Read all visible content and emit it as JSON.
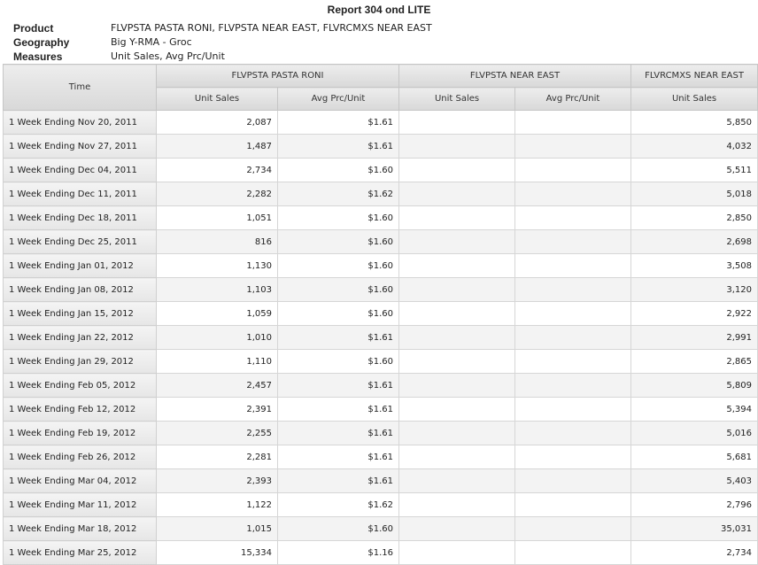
{
  "report": {
    "title": "Report 304 ond LITE",
    "meta": [
      {
        "label": "Product",
        "value": "FLVPSTA PASTA RONI, FLVPSTA NEAR EAST, FLVRCMXS NEAR EAST"
      },
      {
        "label": "Geography",
        "value": "Big Y-RMA - Groc"
      },
      {
        "label": "Measures",
        "value": "Unit Sales, Avg Prc/Unit"
      }
    ]
  },
  "table": {
    "time_header": "Time",
    "groups": [
      "FLVPSTA PASTA RONI",
      "FLVPSTA NEAR EAST",
      "FLVRCMXS NEAR EAST"
    ],
    "subheaders": [
      "Unit Sales",
      "Avg Prc/Unit",
      "Unit Sales",
      "Avg Prc/Unit",
      "Unit Sales"
    ],
    "rows": [
      {
        "time": "1 Week Ending Nov 20, 2011",
        "c1": "2,087",
        "c2": "$1.61",
        "c3": "",
        "c4": "",
        "c5": "5,850"
      },
      {
        "time": "1 Week Ending Nov 27, 2011",
        "c1": "1,487",
        "c2": "$1.61",
        "c3": "",
        "c4": "",
        "c5": "4,032"
      },
      {
        "time": "1 Week Ending Dec 04, 2011",
        "c1": "2,734",
        "c2": "$1.60",
        "c3": "",
        "c4": "",
        "c5": "5,511"
      },
      {
        "time": "1 Week Ending Dec 11, 2011",
        "c1": "2,282",
        "c2": "$1.62",
        "c3": "",
        "c4": "",
        "c5": "5,018"
      },
      {
        "time": "1 Week Ending Dec 18, 2011",
        "c1": "1,051",
        "c2": "$1.60",
        "c3": "",
        "c4": "",
        "c5": "2,850"
      },
      {
        "time": "1 Week Ending Dec 25, 2011",
        "c1": "816",
        "c2": "$1.60",
        "c3": "",
        "c4": "",
        "c5": "2,698"
      },
      {
        "time": "1 Week Ending Jan 01, 2012",
        "c1": "1,130",
        "c2": "$1.60",
        "c3": "",
        "c4": "",
        "c5": "3,508"
      },
      {
        "time": "1 Week Ending Jan 08, 2012",
        "c1": "1,103",
        "c2": "$1.60",
        "c3": "",
        "c4": "",
        "c5": "3,120"
      },
      {
        "time": "1 Week Ending Jan 15, 2012",
        "c1": "1,059",
        "c2": "$1.60",
        "c3": "",
        "c4": "",
        "c5": "2,922"
      },
      {
        "time": "1 Week Ending Jan 22, 2012",
        "c1": "1,010",
        "c2": "$1.61",
        "c3": "",
        "c4": "",
        "c5": "2,991"
      },
      {
        "time": "1 Week Ending Jan 29, 2012",
        "c1": "1,110",
        "c2": "$1.60",
        "c3": "",
        "c4": "",
        "c5": "2,865"
      },
      {
        "time": "1 Week Ending Feb 05, 2012",
        "c1": "2,457",
        "c2": "$1.61",
        "c3": "",
        "c4": "",
        "c5": "5,809"
      },
      {
        "time": "1 Week Ending Feb 12, 2012",
        "c1": "2,391",
        "c2": "$1.61",
        "c3": "",
        "c4": "",
        "c5": "5,394"
      },
      {
        "time": "1 Week Ending Feb 19, 2012",
        "c1": "2,255",
        "c2": "$1.61",
        "c3": "",
        "c4": "",
        "c5": "5,016"
      },
      {
        "time": "1 Week Ending Feb 26, 2012",
        "c1": "2,281",
        "c2": "$1.61",
        "c3": "",
        "c4": "",
        "c5": "5,681"
      },
      {
        "time": "1 Week Ending Mar 04, 2012",
        "c1": "2,393",
        "c2": "$1.61",
        "c3": "",
        "c4": "",
        "c5": "5,403"
      },
      {
        "time": "1 Week Ending Mar 11, 2012",
        "c1": "1,122",
        "c2": "$1.62",
        "c3": "",
        "c4": "",
        "c5": "2,796"
      },
      {
        "time": "1 Week Ending Mar 18, 2012",
        "c1": "1,015",
        "c2": "$1.60",
        "c3": "",
        "c4": "",
        "c5": "35,031"
      },
      {
        "time": "1 Week Ending Mar 25, 2012",
        "c1": "15,334",
        "c2": "$1.16",
        "c3": "",
        "c4": "",
        "c5": "2,734"
      }
    ]
  }
}
